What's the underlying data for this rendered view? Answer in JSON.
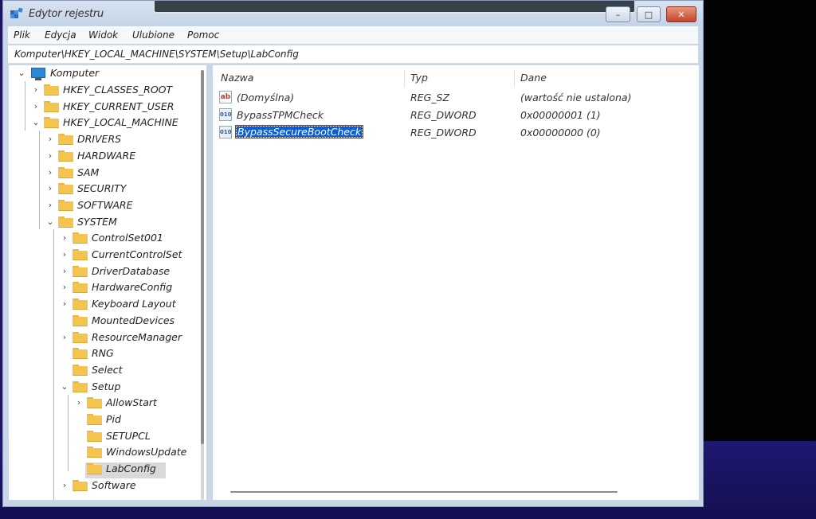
{
  "window": {
    "title": "Edytor rejestru",
    "controls": {
      "minimize": "–",
      "maximize": "□",
      "close": "✕"
    }
  },
  "menu": [
    "Plik",
    "Edycja",
    "Widok",
    "Ulubione",
    "Pomoc"
  ],
  "address": "Komputer\\HKEY_LOCAL_MACHINE\\SYSTEM\\Setup\\LabConfig",
  "tree": {
    "root": "Komputer",
    "items": [
      {
        "label": "HKEY_CLASSES_ROOT",
        "level": 1,
        "state": "collapsed"
      },
      {
        "label": "HKEY_CURRENT_USER",
        "level": 1,
        "state": "collapsed"
      },
      {
        "label": "HKEY_LOCAL_MACHINE",
        "level": 1,
        "state": "expanded"
      },
      {
        "label": "DRIVERS",
        "level": 2,
        "state": "collapsed"
      },
      {
        "label": "HARDWARE",
        "level": 2,
        "state": "collapsed"
      },
      {
        "label": "SAM",
        "level": 2,
        "state": "collapsed"
      },
      {
        "label": "SECURITY",
        "level": 2,
        "state": "collapsed"
      },
      {
        "label": "SOFTWARE",
        "level": 2,
        "state": "collapsed"
      },
      {
        "label": "SYSTEM",
        "level": 2,
        "state": "expanded"
      },
      {
        "label": "ControlSet001",
        "level": 3,
        "state": "collapsed"
      },
      {
        "label": "CurrentControlSet",
        "level": 3,
        "state": "collapsed"
      },
      {
        "label": "DriverDatabase",
        "level": 3,
        "state": "collapsed"
      },
      {
        "label": "HardwareConfig",
        "level": 3,
        "state": "collapsed"
      },
      {
        "label": "Keyboard Layout",
        "level": 3,
        "state": "collapsed"
      },
      {
        "label": "MountedDevices",
        "level": 3,
        "state": "leaf"
      },
      {
        "label": "ResourceManager",
        "level": 3,
        "state": "collapsed"
      },
      {
        "label": "RNG",
        "level": 3,
        "state": "leaf"
      },
      {
        "label": "Select",
        "level": 3,
        "state": "leaf"
      },
      {
        "label": "Setup",
        "level": 3,
        "state": "expanded"
      },
      {
        "label": "AllowStart",
        "level": 4,
        "state": "collapsed"
      },
      {
        "label": "Pid",
        "level": 4,
        "state": "leaf"
      },
      {
        "label": "SETUPCL",
        "level": 4,
        "state": "leaf"
      },
      {
        "label": "WindowsUpdate",
        "level": 4,
        "state": "leaf"
      },
      {
        "label": "LabConfig",
        "level": 4,
        "state": "leaf",
        "selected": true
      },
      {
        "label": "Software",
        "level": 3,
        "state": "collapsed"
      }
    ]
  },
  "list": {
    "columns": [
      "Nazwa",
      "Typ",
      "Dane"
    ],
    "rows": [
      {
        "icon": "string-value-icon",
        "icon_text": "ab",
        "name": "(Domyślna)",
        "type": "REG_SZ",
        "data": "(wartość nie ustalona)"
      },
      {
        "icon": "dword-value-icon",
        "icon_text": "010",
        "name": "BypassTPMCheck",
        "type": "REG_DWORD",
        "data": "0x00000001 (1)"
      },
      {
        "icon": "dword-value-icon",
        "icon_text": "010",
        "name": "BypassSecureBootCheck",
        "type": "REG_DWORD",
        "data": "0x00000000 (0)",
        "selected": true
      }
    ]
  }
}
